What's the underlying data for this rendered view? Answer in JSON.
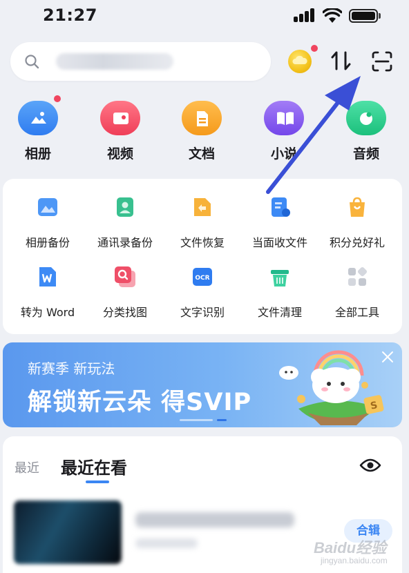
{
  "status_bar": {
    "time": "21:27"
  },
  "search": {
    "placeholder": ""
  },
  "categories": [
    {
      "label": "相册",
      "color": "#3e8ef5",
      "icon": "photo-album-icon",
      "badge": true
    },
    {
      "label": "视频",
      "color": "#f4546a",
      "icon": "video-icon",
      "badge": false
    },
    {
      "label": "文档",
      "color": "#f6a42f",
      "icon": "document-icon",
      "badge": false
    },
    {
      "label": "小说",
      "color": "#8a5cf0",
      "icon": "book-icon",
      "badge": false
    },
    {
      "label": "音频",
      "color": "#2fcf8f",
      "icon": "audio-icon",
      "badge": false
    }
  ],
  "tools": [
    {
      "label": "相册备份",
      "icon": "photo-backup-icon"
    },
    {
      "label": "通讯录备份",
      "icon": "contacts-backup-icon"
    },
    {
      "label": "文件恢复",
      "icon": "file-restore-icon"
    },
    {
      "label": "当面收文件",
      "icon": "receive-file-icon"
    },
    {
      "label": "积分兑好礼",
      "icon": "points-gift-icon"
    },
    {
      "label": "转为 Word",
      "icon": "convert-word-icon"
    },
    {
      "label": "分类找图",
      "icon": "image-search-icon"
    },
    {
      "label": "文字识别",
      "icon": "ocr-icon"
    },
    {
      "label": "文件清理",
      "icon": "file-cleanup-icon"
    },
    {
      "label": "全部工具",
      "icon": "all-tools-icon"
    }
  ],
  "banner": {
    "subtitle": "新赛季 新玩法",
    "title": "解锁新云朵 得SVIP"
  },
  "recent": {
    "tab_recent": "最近",
    "tab_watching": "最近在看",
    "item_badge": "合辑"
  },
  "watermark": {
    "brand": "Baidu经验",
    "url": "jingyan.baidu.com"
  },
  "colors": {
    "accent": "#3b86f3",
    "badge_red": "#f0455f",
    "arrow": "#3a4fd6"
  }
}
